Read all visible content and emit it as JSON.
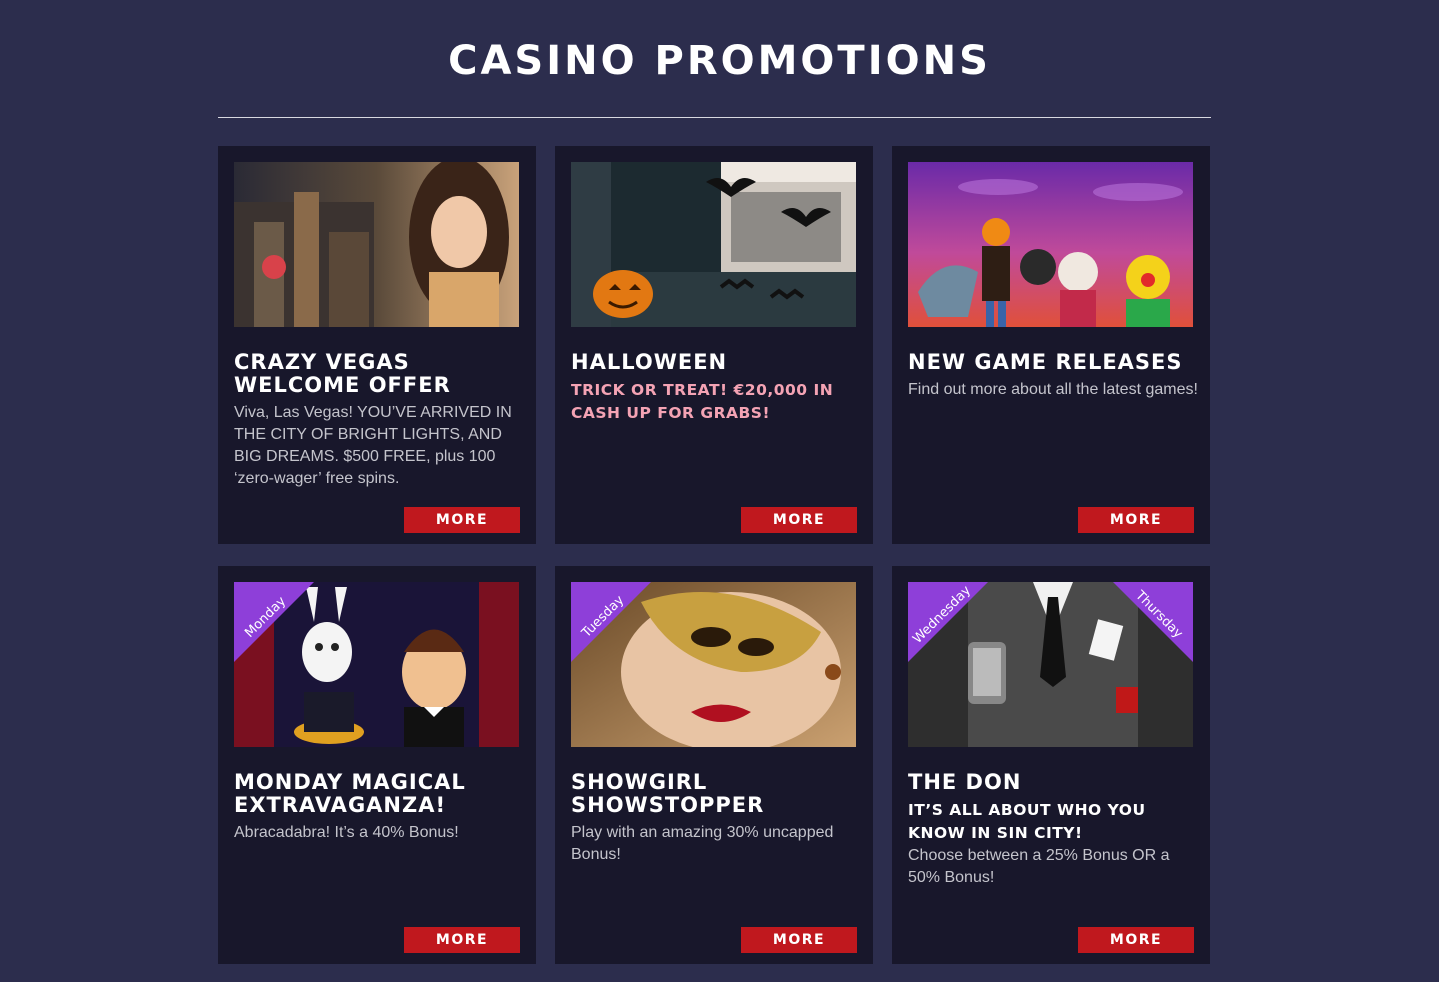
{
  "page": {
    "title": "CASINO PROMOTIONS"
  },
  "colors": {
    "background": "#2c2d4d",
    "card": "#18172b",
    "button": "#c0181e",
    "subtitle_pink": "#f4a3b4",
    "ribbon": "#8e3fd9"
  },
  "promotions": [
    {
      "title": "CRAZY VEGAS WELCOME OFFER",
      "subtitle": "",
      "text": "Viva, Las Vegas! YOU’VE ARRIVED IN THE CITY OF BRIGHT LIGHTS, AND BIG DREAMS. $500 FREE, plus 100 ‘zero-wager’ free spins.",
      "button": "MORE",
      "ribbon_left": "",
      "ribbon_right": ""
    },
    {
      "title": "HALLOWEEN",
      "subtitle": "TRICK OR TREAT! €20,000 IN CASH UP FOR GRABS!",
      "text": "",
      "button": "MORE",
      "ribbon_left": "",
      "ribbon_right": ""
    },
    {
      "title": "NEW GAME RELEASES",
      "subtitle": "",
      "text": "Find out more about all the latest games!",
      "button": "MORE",
      "ribbon_left": "",
      "ribbon_right": ""
    },
    {
      "title": "MONDAY MAGICAL EXTRAVAGANZA!",
      "subtitle": "",
      "text": "Abracadabra! It’s a 40% Bonus!",
      "button": "MORE",
      "ribbon_left": "Monday",
      "ribbon_right": ""
    },
    {
      "title": "SHOWGIRL SHOWSTOPPER",
      "subtitle": "",
      "text": "Play with an amazing 30% uncapped Bonus!",
      "button": "MORE",
      "ribbon_left": "Tuesday",
      "ribbon_right": ""
    },
    {
      "title": "THE DON",
      "subtitle": "IT’S ALL ABOUT WHO YOU KNOW IN SIN CITY!",
      "text": "Choose between a 25% Bonus OR a 50% Bonus!",
      "button": "MORE",
      "ribbon_left": "Wednesday",
      "ribbon_right": "Thursday"
    }
  ]
}
